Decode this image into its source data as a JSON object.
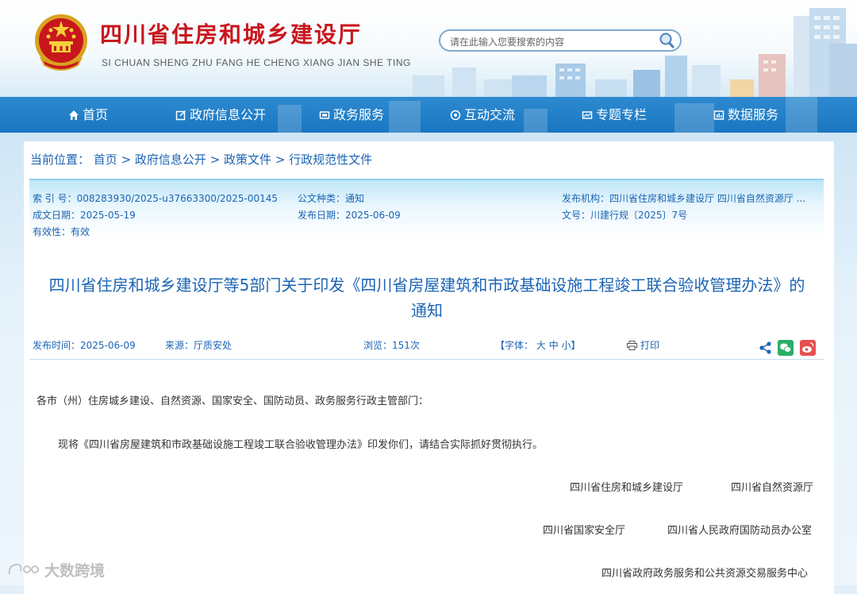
{
  "header": {
    "title": "四川省住房和城乡建设厅",
    "subtitle": "SI CHUAN SHENG ZHU FANG HE CHENG XIANG JIAN SHE TING",
    "search_placeholder": "请在此输入您要搜索的内容"
  },
  "nav": {
    "items": [
      {
        "label": "首页",
        "icon": "home-icon"
      },
      {
        "label": "政府信息公开",
        "icon": "edit-icon"
      },
      {
        "label": "政务服务",
        "icon": "service-icon"
      },
      {
        "label": "互动交流",
        "icon": "interact-icon"
      },
      {
        "label": "专题专栏",
        "icon": "topic-icon"
      },
      {
        "label": "数据服务",
        "icon": "data-icon"
      }
    ]
  },
  "breadcrumb": {
    "label": "当前位置：",
    "items": [
      "首页",
      "政府信息公开",
      "政策文件",
      "行政规范性文件"
    ]
  },
  "meta": {
    "index_no": "索 引 号：008283930/2025-u37663300/2025-00145",
    "doc_type": "公文种类：通知",
    "publisher": "发布机构：四川省住房和城乡建设厅 四川省自然资源厅 ...",
    "created": "成文日期：2025-05-19",
    "published": "发布日期：2025-06-09",
    "doc_no": "文号：川建行规〔2025〕7号",
    "validity": "有效性：有效"
  },
  "article": {
    "title_line1": "四川省住房和城乡建设厅等5部门关于印发《四川省房屋建筑和市政基础设施工程竣工联合验收管理办法》的",
    "title_line2": "通知",
    "publish_time": "发布时间：2025-06-09",
    "source": "来源：厅质安处",
    "views": "浏览：151次",
    "font_label": "【字体：",
    "font_large": "大",
    "font_medium": "中",
    "font_small": "小",
    "font_close": "】",
    "print": "打印",
    "salutation": "各市（州）住房城乡建设、自然资源、国家安全、国防动员、政务服务行政主管部门：",
    "paragraph1": "现将《四川省房屋建筑和市政基础设施工程竣工联合验收管理办法》印发你们，请结合实际抓好贯彻执行。",
    "signatories": [
      "四川省住房和城乡建设厅",
      "四川省自然资源厅",
      "四川省国家安全厅",
      "四川省人民政府国防动员办公室",
      "四川省政府政务服务和公共资源交易服务中心"
    ]
  },
  "watermark": "大数跨境",
  "colors": {
    "accent": "#1c64b4",
    "nav": "#2584cc",
    "title_red": "#c8161d"
  }
}
